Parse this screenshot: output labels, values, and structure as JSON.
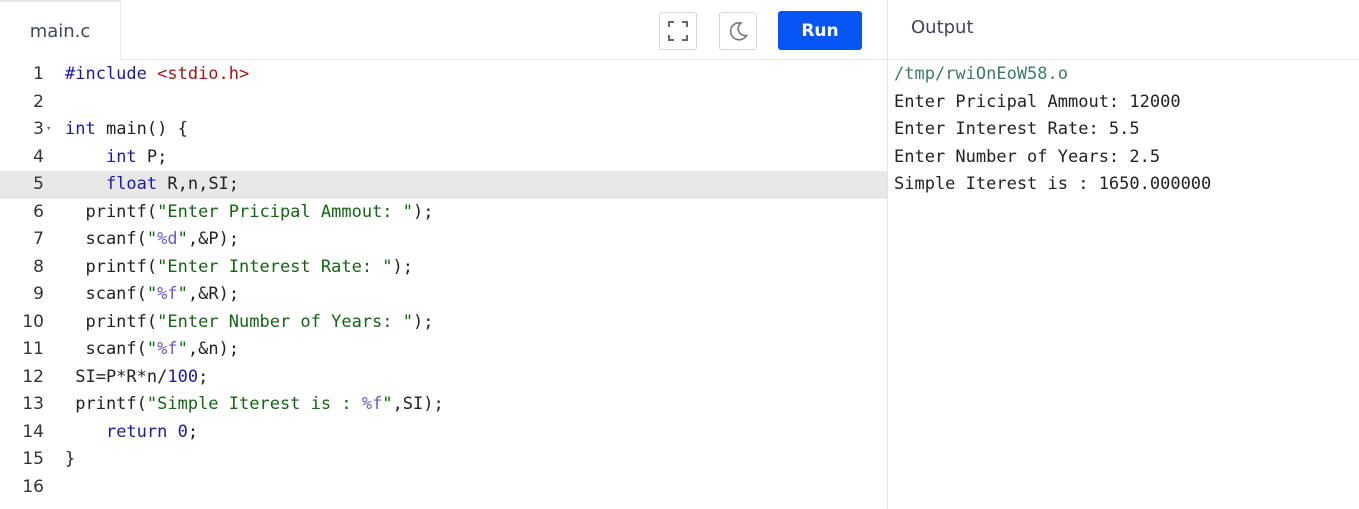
{
  "editor": {
    "tab_label": "main.c",
    "fullscreen_icon": "fullscreen-icon",
    "theme_icon": "moon-icon",
    "run_label": "Run",
    "active_line": 5,
    "colors": {
      "keyword": "#1a1aa6",
      "string": "#116611",
      "include_header": "#a31515",
      "format_spec": "#6a5acd",
      "number": "#1a1aa6",
      "run_button": "#0556f3"
    },
    "lines": [
      {
        "num": "1",
        "segments": [
          {
            "t": "#include ",
            "c": "keyword"
          },
          {
            "t": "<stdio.h>",
            "c": "include_header"
          }
        ]
      },
      {
        "num": "2",
        "segments": []
      },
      {
        "num": "3",
        "fold": true,
        "segments": [
          {
            "t": "int",
            "c": "keyword"
          },
          {
            "t": " main() {",
            "c": "plain"
          }
        ]
      },
      {
        "num": "4",
        "segments": [
          {
            "t": "    ",
            "c": "plain"
          },
          {
            "t": "int",
            "c": "keyword"
          },
          {
            "t": " P;",
            "c": "plain"
          }
        ]
      },
      {
        "num": "5",
        "segments": [
          {
            "t": "    ",
            "c": "plain"
          },
          {
            "t": "float",
            "c": "keyword"
          },
          {
            "t": " R,n,SI;",
            "c": "plain"
          }
        ]
      },
      {
        "num": "6",
        "segments": [
          {
            "t": "  printf(",
            "c": "plain"
          },
          {
            "t": "\"Enter Pricipal Ammout: \"",
            "c": "string"
          },
          {
            "t": ");",
            "c": "plain"
          }
        ]
      },
      {
        "num": "7",
        "segments": [
          {
            "t": "  scanf(",
            "c": "plain"
          },
          {
            "t": "\"",
            "c": "string"
          },
          {
            "t": "%d",
            "c": "format_spec"
          },
          {
            "t": "\"",
            "c": "string"
          },
          {
            "t": ",&P);",
            "c": "plain"
          }
        ]
      },
      {
        "num": "8",
        "segments": [
          {
            "t": "  printf(",
            "c": "plain"
          },
          {
            "t": "\"Enter Interest Rate: \"",
            "c": "string"
          },
          {
            "t": ");",
            "c": "plain"
          }
        ]
      },
      {
        "num": "9",
        "segments": [
          {
            "t": "  scanf(",
            "c": "plain"
          },
          {
            "t": "\"",
            "c": "string"
          },
          {
            "t": "%f",
            "c": "format_spec"
          },
          {
            "t": "\"",
            "c": "string"
          },
          {
            "t": ",&R);",
            "c": "plain"
          }
        ]
      },
      {
        "num": "10",
        "segments": [
          {
            "t": "  printf(",
            "c": "plain"
          },
          {
            "t": "\"Enter Number of Years: \"",
            "c": "string"
          },
          {
            "t": ");",
            "c": "plain"
          }
        ]
      },
      {
        "num": "11",
        "segments": [
          {
            "t": "  scanf(",
            "c": "plain"
          },
          {
            "t": "\"",
            "c": "string"
          },
          {
            "t": "%f",
            "c": "format_spec"
          },
          {
            "t": "\"",
            "c": "string"
          },
          {
            "t": ",&n);",
            "c": "plain"
          }
        ]
      },
      {
        "num": "12",
        "segments": [
          {
            "t": " SI=P*R*n/",
            "c": "plain"
          },
          {
            "t": "100",
            "c": "number"
          },
          {
            "t": ";",
            "c": "plain"
          }
        ]
      },
      {
        "num": "13",
        "segments": [
          {
            "t": " printf(",
            "c": "plain"
          },
          {
            "t": "\"Simple Iterest is : ",
            "c": "string"
          },
          {
            "t": "%f",
            "c": "format_spec"
          },
          {
            "t": "\"",
            "c": "string"
          },
          {
            "t": ",SI);",
            "c": "plain"
          }
        ]
      },
      {
        "num": "14",
        "segments": [
          {
            "t": "    ",
            "c": "plain"
          },
          {
            "t": "return",
            "c": "keyword"
          },
          {
            "t": " ",
            "c": "plain"
          },
          {
            "t": "0",
            "c": "number"
          },
          {
            "t": ";",
            "c": "plain"
          }
        ]
      },
      {
        "num": "15",
        "segments": [
          {
            "t": "}",
            "c": "plain"
          }
        ]
      },
      {
        "num": "16",
        "segments": []
      }
    ]
  },
  "output": {
    "title": "Output",
    "lines": [
      "/tmp/rwiOnEoW58.o",
      "Enter Pricipal Ammout: 12000",
      "Enter Interest Rate: 5.5",
      "Enter Number of Years: 2.5",
      "Simple Iterest is : 1650.000000"
    ]
  }
}
